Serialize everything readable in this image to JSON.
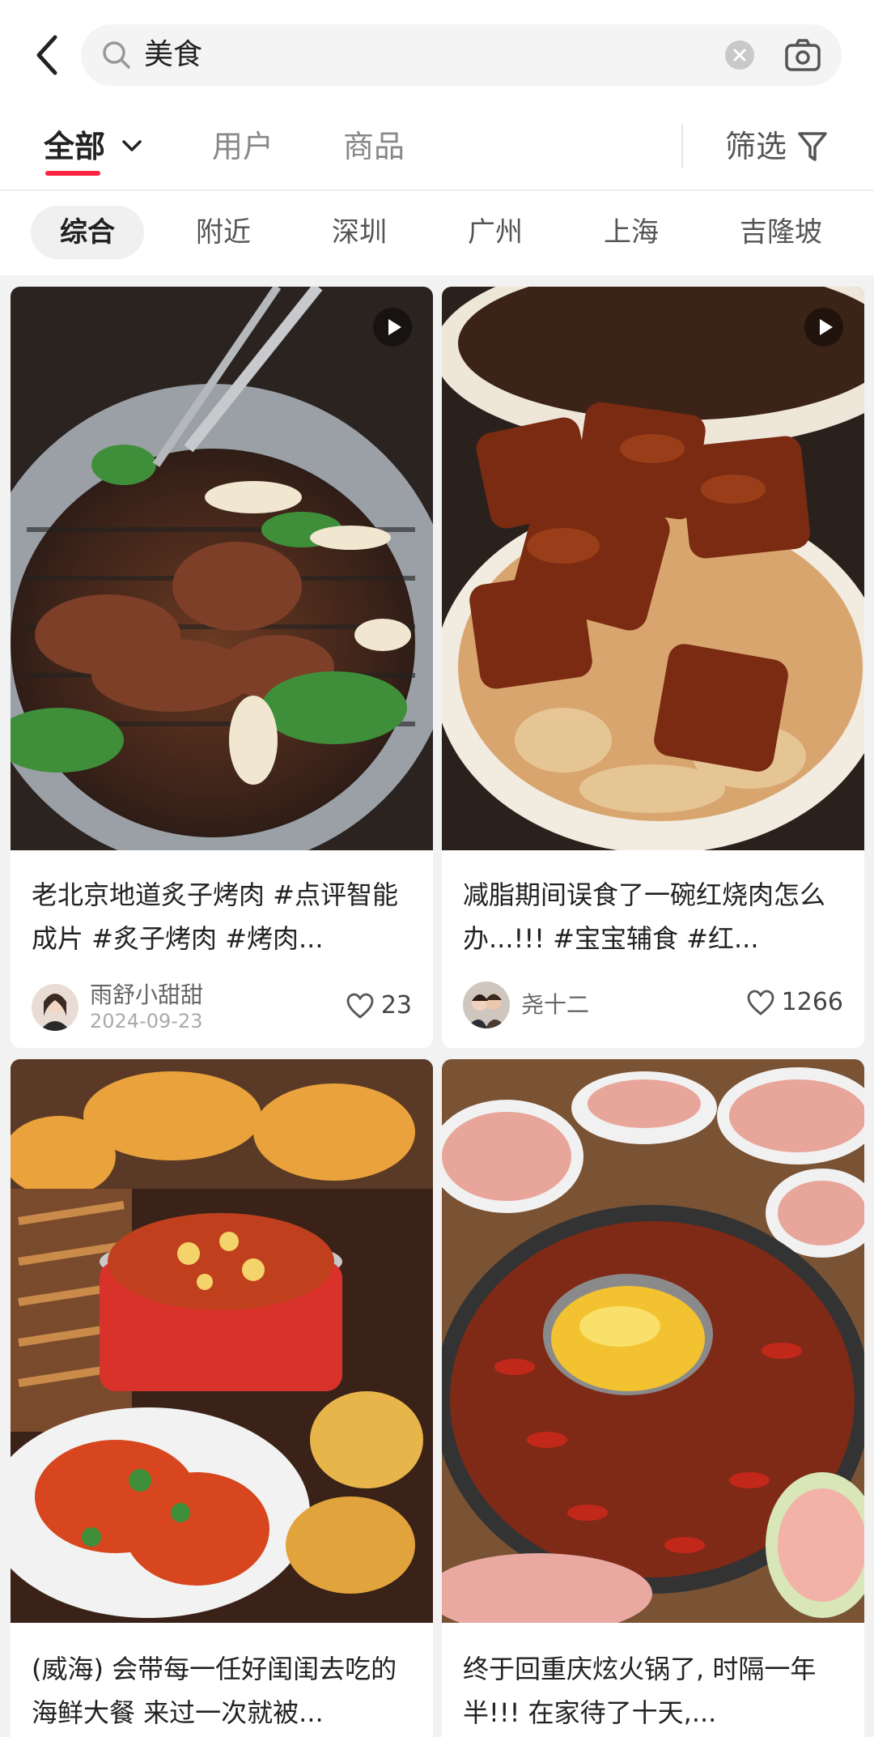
{
  "search": {
    "query": "美食"
  },
  "tabs": {
    "all": "全部",
    "users": "用户",
    "goods": "商品",
    "filter": "筛选"
  },
  "chips": [
    "综合",
    "附近",
    "深圳",
    "广州",
    "上海",
    "吉隆坡"
  ],
  "colors": {
    "accent": "#ff2442"
  },
  "cards": [
    {
      "title": "老北京地道炙子烤肉 #点评智能成片 #炙子烤肉 #烤肉...",
      "author": "雨舒小甜甜",
      "date": "2024-09-23",
      "likes": "23",
      "video": true
    },
    {
      "title": "减脂期间误食了一碗红烧肉怎么办...!!! #宝宝辅食 #红...",
      "author": "尧十二",
      "likes": "1266",
      "video": true
    },
    {
      "title": "(威海) 会带每一任好闺闺去吃的海鲜大餐 来过一次就被..."
    },
    {
      "title": "终于回重庆炫火锅了, 时隔一年半!!! 在家待了十天,..."
    }
  ]
}
